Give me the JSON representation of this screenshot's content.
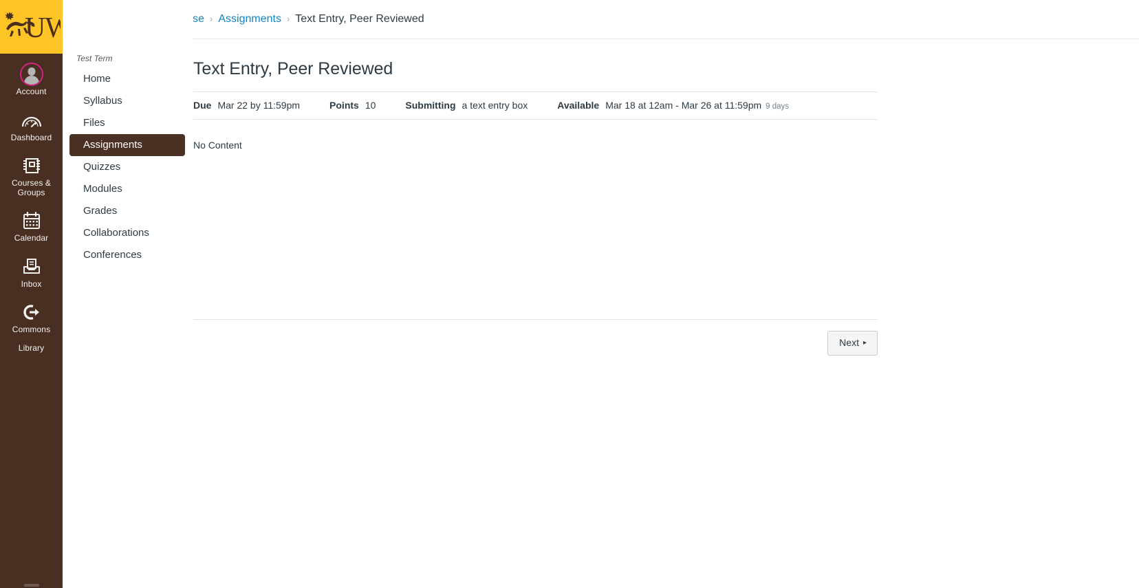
{
  "brand": {
    "logo_text": "UW",
    "logo_icon": "bucking-horse-icon",
    "gold": "#ffc425",
    "brown": "#492f22",
    "accent_blue": "#1283c4",
    "avatar_ring": "#d6217f"
  },
  "global_nav": {
    "items": [
      {
        "label": "Account",
        "icon": "user-avatar-icon"
      },
      {
        "label": "Dashboard",
        "icon": "dashboard-gauge-icon"
      },
      {
        "label": "Courses & Groups",
        "icon": "courses-book-icon"
      },
      {
        "label": "Calendar",
        "icon": "calendar-icon"
      },
      {
        "label": "Inbox",
        "icon": "inbox-tray-icon"
      },
      {
        "label": "Commons",
        "icon": "commons-arrow-icon"
      },
      {
        "label": "Library",
        "icon": ""
      }
    ]
  },
  "topbar": {
    "menu_icon": "hamburger-menu-icon",
    "breadcrumb": [
      {
        "label": "TEST Jim's Course",
        "link": true
      },
      {
        "label": "Assignments",
        "link": true
      },
      {
        "label": "Text Entry, Peer Reviewed",
        "link": false
      }
    ],
    "separator": "›"
  },
  "course_nav": {
    "term": "Test Term",
    "items": [
      {
        "label": "Home",
        "active": false
      },
      {
        "label": "Syllabus",
        "active": false
      },
      {
        "label": "Files",
        "active": false
      },
      {
        "label": "Assignments",
        "active": true
      },
      {
        "label": "Quizzes",
        "active": false
      },
      {
        "label": "Modules",
        "active": false
      },
      {
        "label": "Grades",
        "active": false
      },
      {
        "label": "Collaborations",
        "active": false
      },
      {
        "label": "Conferences",
        "active": false
      }
    ]
  },
  "assignment": {
    "title": "Text Entry, Peer Reviewed",
    "details": [
      {
        "label": "Due",
        "value": "Mar 22 by 11:59pm",
        "sub": ""
      },
      {
        "label": "Points",
        "value": "10",
        "sub": ""
      },
      {
        "label": "Submitting",
        "value": "a text entry box",
        "sub": ""
      },
      {
        "label": "Available",
        "value": "Mar 18 at 12am - Mar 26 at 11:59pm",
        "sub": "9 days"
      }
    ],
    "description": "No Content"
  },
  "footer": {
    "next_label": "Next",
    "next_caret": "▸"
  }
}
